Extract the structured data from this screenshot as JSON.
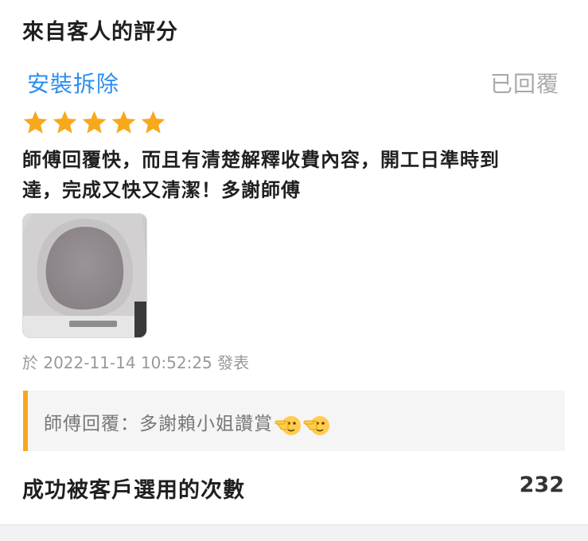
{
  "section_title": "來自客人的評分",
  "review": {
    "service_name": "安裝拆除",
    "status": "已回覆",
    "rating": 5,
    "rating_max": 5,
    "star_color": "#f7a81b",
    "text_line1": "師傅回覆快，而且有清楚解釋收費內容，開工日準時到",
    "text_line2": "達，完成又快又清潔！多謝師傅",
    "photo_icon": "toilet-seat-photo",
    "timestamp": "於 2022-11-14 10:52:25 發表"
  },
  "reply": {
    "text": "師傅回覆：多謝賴小姐讚賞",
    "emojis": [
      "pointing-left-face-icon",
      "pointing-left-face-icon"
    ],
    "accent_color": "#f7a81b"
  },
  "times_selected": {
    "label": "成功被客戶選用的次數",
    "value": "232"
  },
  "colors": {
    "link_blue": "#2b8ef0",
    "muted_gray": "#a9a9a9"
  }
}
